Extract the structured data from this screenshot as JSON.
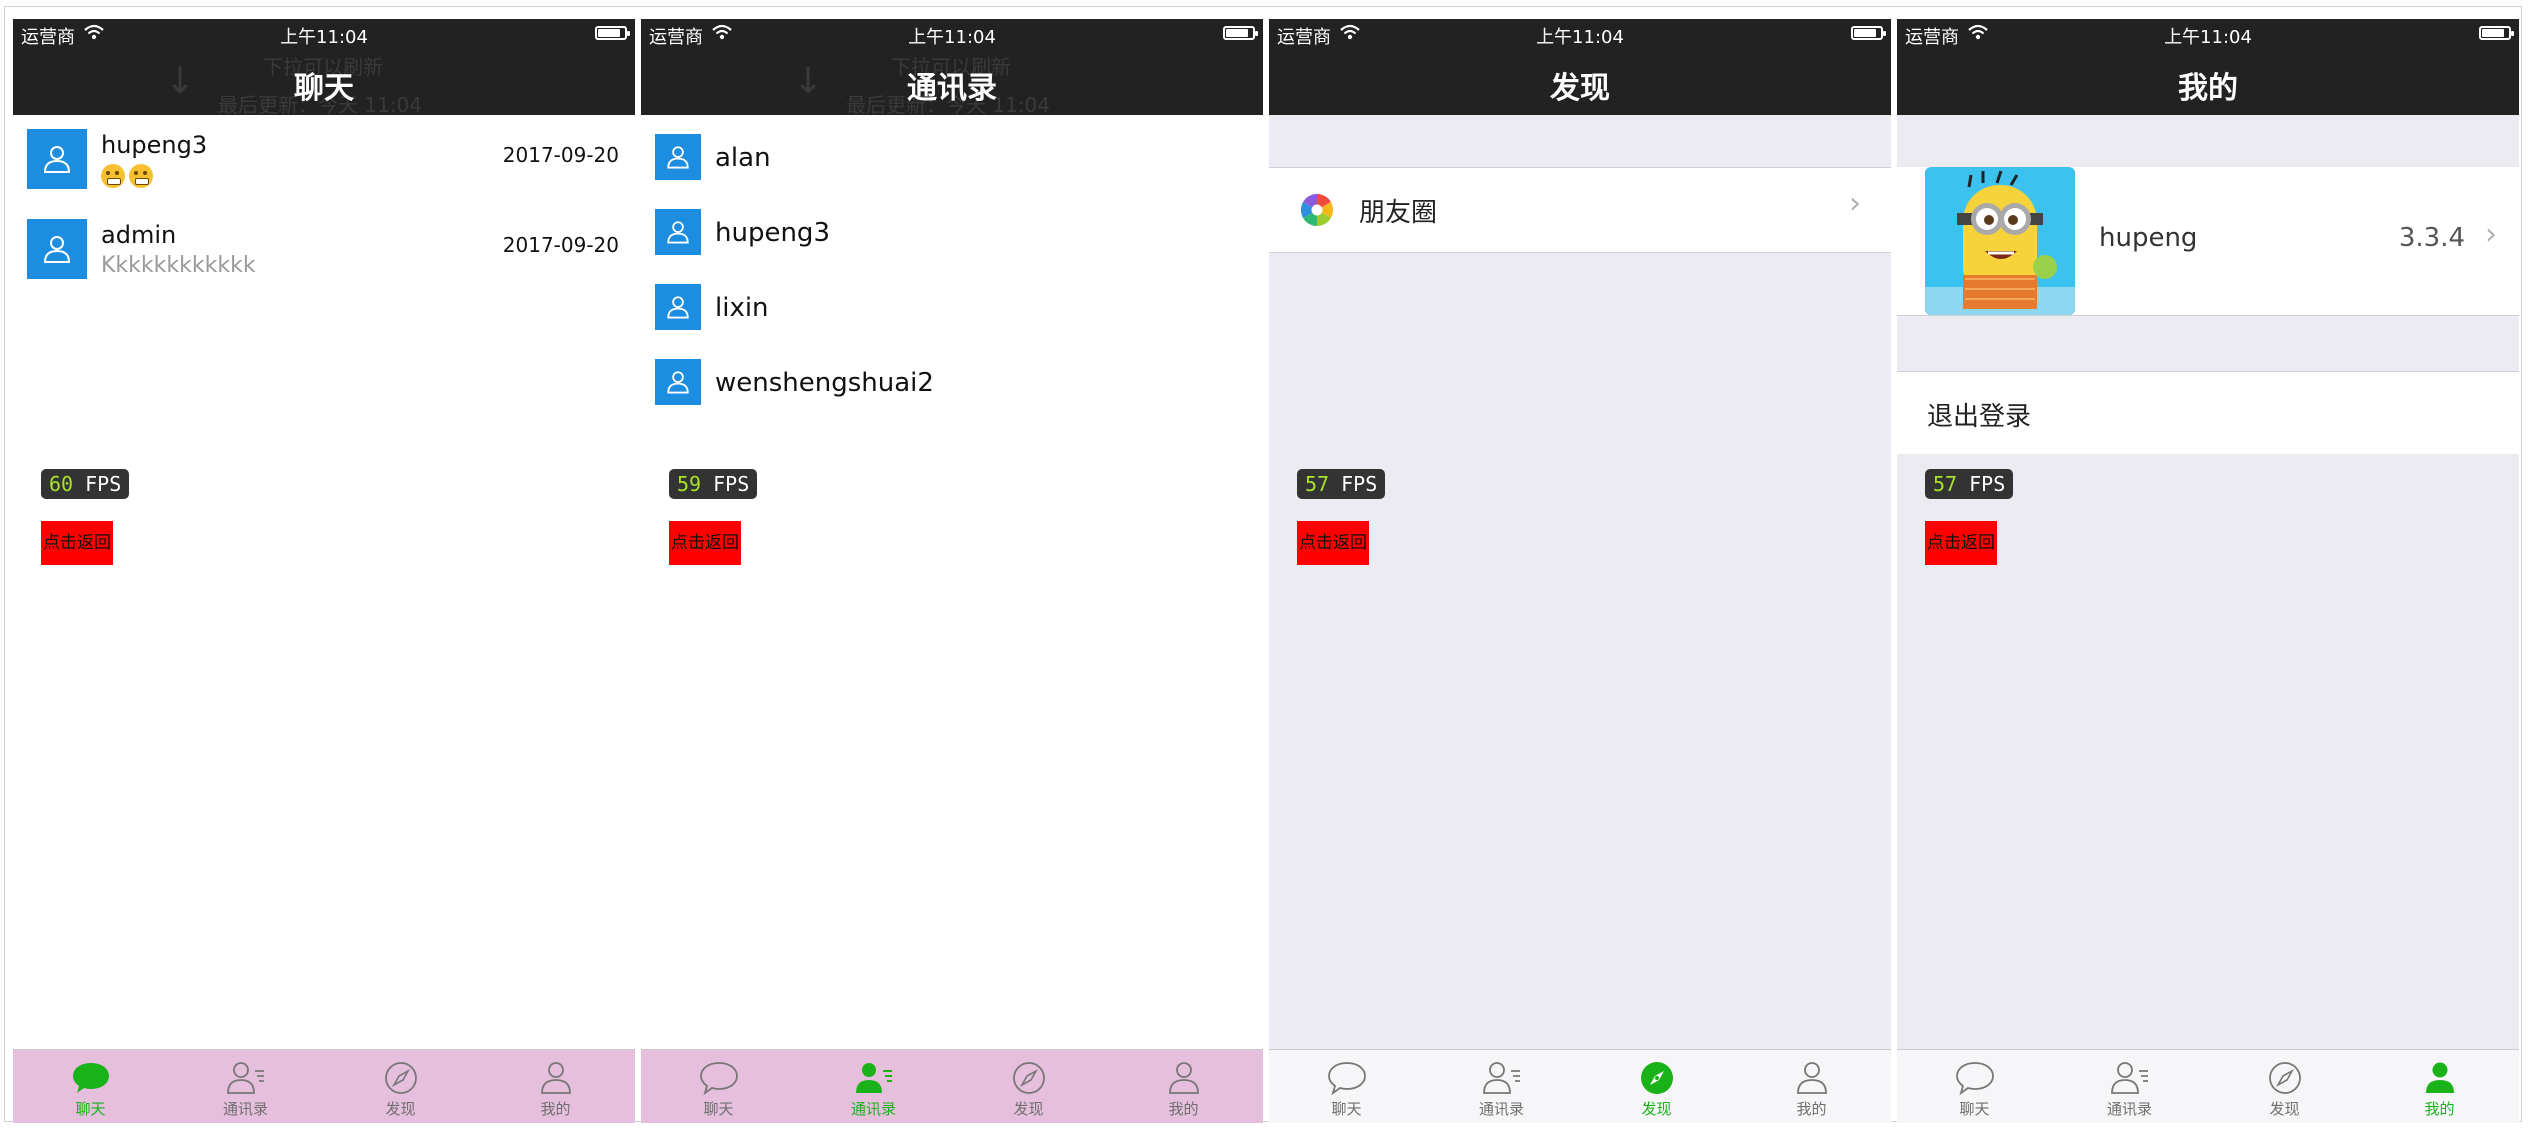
{
  "status_bar": {
    "carrier": "运营商",
    "time": "上午11:04"
  },
  "ghost_refresh": {
    "line1": "下拉可以刷新",
    "line2": "最后更新：今天 11:04"
  },
  "screens": [
    {
      "title": "聊天",
      "chats": [
        {
          "name": "hupeng3",
          "message": "",
          "emoji_count": 2,
          "date": "2017-09-20"
        },
        {
          "name": "admin",
          "message": "Kkkkkkkkkkkk",
          "date": "2017-09-20"
        }
      ],
      "fps": "60",
      "tab_active": 0,
      "tabbar_bg": "#e6bfdc"
    },
    {
      "title": "通讯录",
      "contacts": [
        "alan",
        "hupeng3",
        "lixin",
        "wenshengshuai2"
      ],
      "fps": "59",
      "tab_active": 1,
      "tabbar_bg": "#e6bfdc"
    },
    {
      "title": "发现",
      "moments_label": "朋友圈",
      "fps": "57",
      "tab_active": 2,
      "tabbar_bg": "#f6f6f8"
    },
    {
      "title": "我的",
      "profile_name": "hupeng",
      "version": "3.3.4",
      "logout_label": "退出登录",
      "fps": "57",
      "tab_active": 3,
      "tabbar_bg": "#f6f6f8"
    }
  ],
  "fps_suffix": "FPS",
  "back_button_label": "点击返回",
  "tabs": [
    {
      "label": "聊天",
      "icon": "chat-bubble-icon"
    },
    {
      "label": "通讯录",
      "icon": "contacts-icon"
    },
    {
      "label": "发现",
      "icon": "compass-icon"
    },
    {
      "label": "我的",
      "icon": "person-icon"
    }
  ],
  "colors": {
    "bar_dark": "#222222",
    "accent_green": "#19b319",
    "avatar_blue": "#1d8de0",
    "fps_green": "#a8e22a",
    "back_red": "#ff0000"
  }
}
